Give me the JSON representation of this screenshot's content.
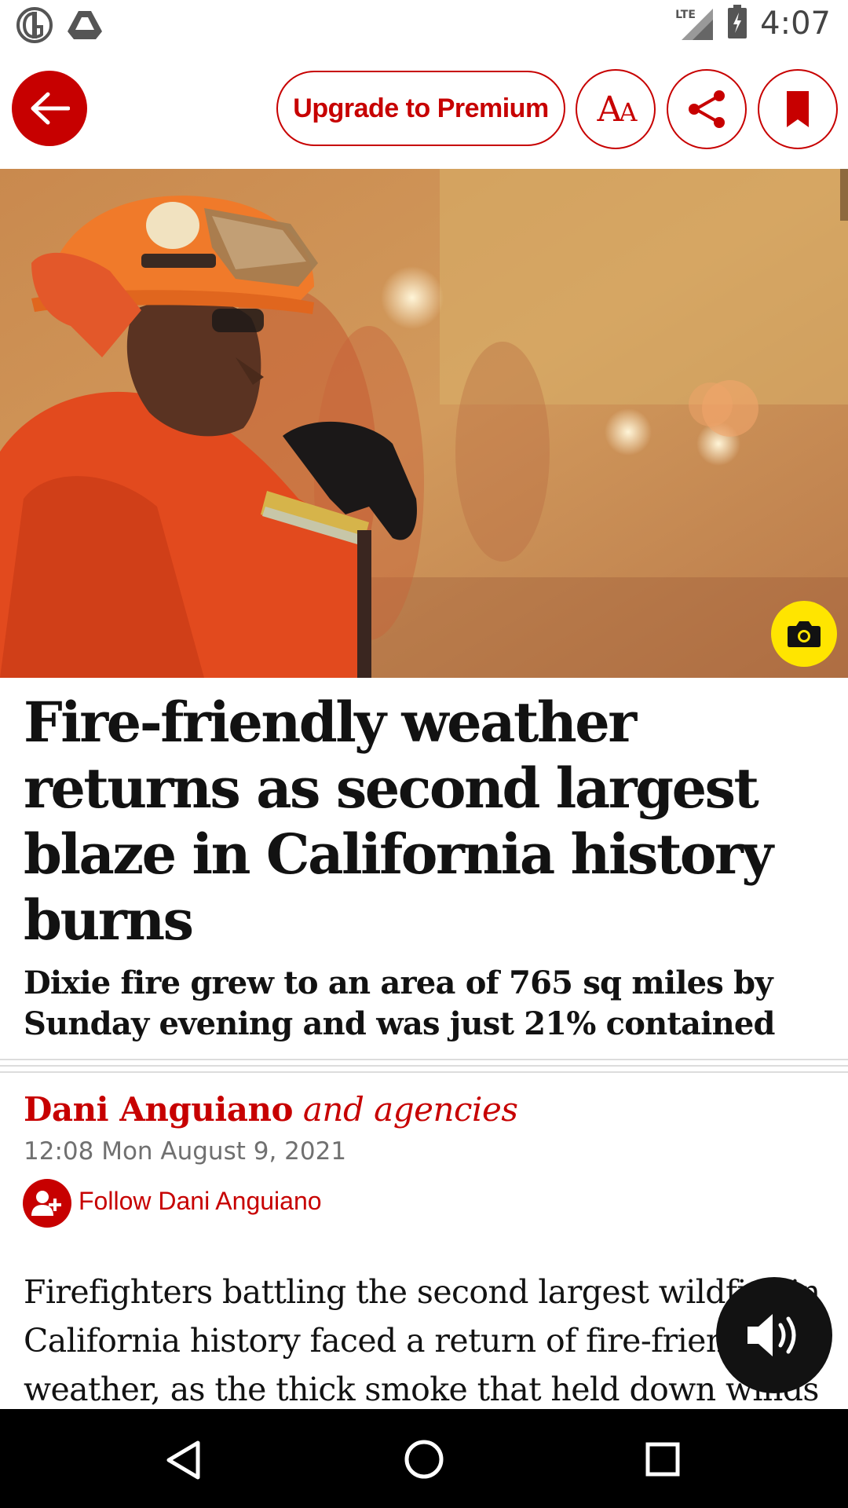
{
  "status_bar": {
    "time": "4:07",
    "network": "LTE",
    "icons": [
      "guardian-g-icon",
      "drive-icon",
      "signal-icon",
      "battery-icon"
    ]
  },
  "toolbar": {
    "back_icon": "arrow-left-icon",
    "premium_label": "Upgrade to Premium",
    "text_size_label_big": "A",
    "text_size_label_small": "A",
    "share_icon": "share-icon",
    "bookmark_icon": "bookmark-icon"
  },
  "hero": {
    "image_icon": "camera-icon"
  },
  "article": {
    "headline": "Fire-friendly weather returns as second largest blaze in California history burns",
    "standfirst": "Dixie fire grew to an area of 765 sq miles by Sunday evening and was just 21% contained",
    "byline_name": "Dani Anguiano",
    "byline_suffix": "and agencies",
    "dateline": "12:08 Mon August 9, 2021",
    "follow_label": "Follow Dani Anguiano",
    "body": "Firefighters battling the second largest wildfire in California history faced a return of fire-friendly weather, as the thick smoke that held down winds"
  },
  "audio": {
    "icon": "speaker-icon"
  },
  "colors": {
    "accent": "#c70000",
    "camera_button": "#ffe500",
    "text": "#121212",
    "meta": "#707070"
  }
}
